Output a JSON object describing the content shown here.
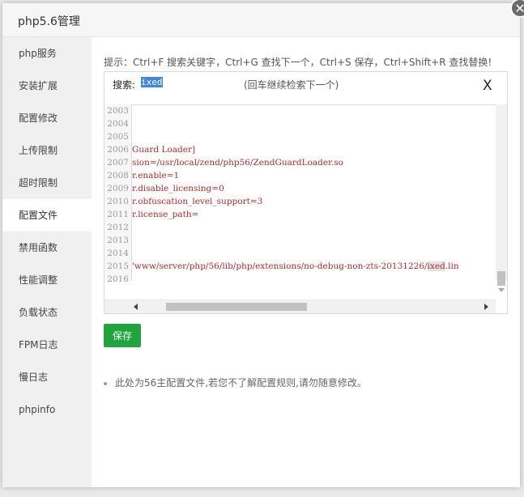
{
  "dialog": {
    "title": "php5.6管理",
    "close_symbol": "✕"
  },
  "sidebar": {
    "items": [
      {
        "label": "php服务"
      },
      {
        "label": "安装扩展"
      },
      {
        "label": "配置修改"
      },
      {
        "label": "上传限制"
      },
      {
        "label": "超时限制"
      },
      {
        "label": "配置文件",
        "active": true
      },
      {
        "label": "禁用函数"
      },
      {
        "label": "性能调整"
      },
      {
        "label": "负载状态"
      },
      {
        "label": "FPM日志"
      },
      {
        "label": "慢日志"
      },
      {
        "label": "phpinfo"
      }
    ]
  },
  "tip": "提示：Ctrl+F 搜索关键字，Ctrl+G 查找下一个，Ctrl+S 保存，Ctrl+Shift+R 查找替换!",
  "search": {
    "label": "搜索:",
    "value": "ixed",
    "hint": "(回车继续检索下一个)",
    "close": "X"
  },
  "editor": {
    "lines": [
      {
        "no": "2003",
        "text": ""
      },
      {
        "no": "2004",
        "text": ""
      },
      {
        "no": "2005",
        "text": ""
      },
      {
        "no": "2006",
        "text": "Guard Loader]"
      },
      {
        "no": "2007",
        "text": "sion=/usr/local/zend/php56/ZendGuardLoader.so"
      },
      {
        "no": "2008",
        "text": "r.enable=1"
      },
      {
        "no": "2009",
        "text": "r.disable_licensing=0"
      },
      {
        "no": "2010",
        "text": "r.obfuscation_level_support=3"
      },
      {
        "no": "2011",
        "text": "r.license_path="
      },
      {
        "no": "2012",
        "text": ""
      },
      {
        "no": "2013",
        "text": ""
      },
      {
        "no": "2014",
        "text": ""
      },
      {
        "no": "2015",
        "text": "'www/server/php/56/lib/php/extensions/no-debug-non-zts-20131226/",
        "highlight": "ixed",
        "after": ".lin"
      },
      {
        "no": "2016",
        "text": ""
      }
    ]
  },
  "save_label": "保存",
  "note": "此处为56主配置文件,若您不了解配置规则,请勿随意修改。",
  "colors": {
    "save_button": "#20a53a",
    "code_text": "#b02a2a",
    "search_selection": "#3f86e6"
  }
}
